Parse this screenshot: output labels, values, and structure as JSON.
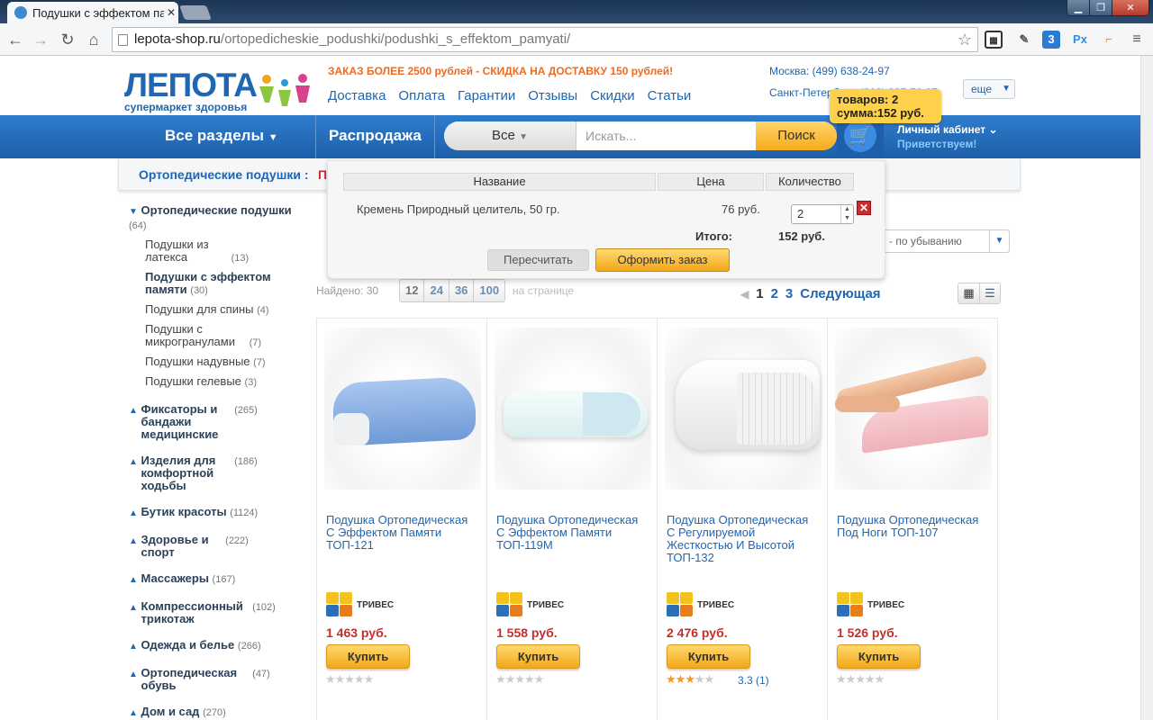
{
  "browser": {
    "tab_title": "Подушки с эффектом па",
    "url_host": "lepota-shop.ru",
    "url_path": "/ortopedicheskie_podushki/podushki_s_effektom_pamyati/"
  },
  "header": {
    "logo_text": "ЛЕПОТА",
    "logo_sub": "супермаркет здоровья",
    "promo": "ЗАКАЗ БОЛЕЕ 2500 рублей - СКИДКА НА ДОСТАВКУ 150 рублей!",
    "nav": [
      "Доставка",
      "Оплата",
      "Гарантии",
      "Отзывы",
      "Скидки",
      "Статьи"
    ],
    "phone_moscow": "Москва: (499) 638-24-97",
    "phone_spb": "Санкт-Петербург: (812) 385-56-97",
    "more_label": "еще"
  },
  "bluebar": {
    "all_sections": "Все разделы",
    "sale": "Распродажа",
    "search_scope": "Все",
    "search_placeholder": "Искать...",
    "search_button": "Поиск",
    "cabinet": "Личный кабинет",
    "greeting": "Приветствуем!"
  },
  "cart_badge": {
    "items": "товаров: 2",
    "sum": "сумма:152 руб."
  },
  "breadcrumb": {
    "parent": "Ортопедические подушки :",
    "current": "П"
  },
  "sidebar": {
    "open_category": {
      "label": "Ортопедические подушки",
      "count": "(64)"
    },
    "subcategories": [
      {
        "label": "Подушки из латекса",
        "count": "(13)"
      },
      {
        "label": "Подушки с эффектом памяти",
        "count": "(30)"
      },
      {
        "label": "Подушки для спины",
        "count": "(4)"
      },
      {
        "label": "Подушки с микрогранулами",
        "count": "(7)"
      },
      {
        "label": "Подушки надувные",
        "count": "(7)"
      },
      {
        "label": "Подушки гелевые",
        "count": "(3)"
      }
    ],
    "categories": [
      {
        "label": "Фиксаторы и бандажи медицинские",
        "count": "(265)"
      },
      {
        "label": "Изделия для комфортной ходьбы",
        "count": "(186)"
      },
      {
        "label": "Бутик красоты",
        "count": "(1124)"
      },
      {
        "label": "Здоровье и спорт",
        "count": "(222)"
      },
      {
        "label": "Массажеры",
        "count": "(167)"
      },
      {
        "label": "Компрессионный трикотаж",
        "count": "(102)"
      },
      {
        "label": "Одежда и белье",
        "count": "(266)"
      },
      {
        "label": "Ортопедическая обувь",
        "count": "(47)"
      },
      {
        "label": "Дом и сад",
        "count": "(270)"
      }
    ]
  },
  "listing": {
    "sort_label": "- по убыванию",
    "found": "Найдено: 30",
    "per_page_options": [
      "12",
      "24",
      "36",
      "100"
    ],
    "per_page_label": "на странице",
    "pages": [
      "1",
      "2",
      "3"
    ],
    "next": "Следующая"
  },
  "products": [
    {
      "title": "Подушка Ортопедическая С Эффектом Памяти ТОП-121",
      "brand": "ТРИВЕС",
      "price": "1 463 руб.",
      "buy": "Купить",
      "stars": 0,
      "rating": ""
    },
    {
      "title": "Подушка Ортопедическая С Эффектом Памяти ТОП-119М",
      "brand": "ТРИВЕС",
      "price": "1 558 руб.",
      "buy": "Купить",
      "stars": 0,
      "rating": ""
    },
    {
      "title": "Подушка Ортопедическая С Регулируемой Жесткостью И Высотой ТОП-132",
      "brand": "ТРИВЕС",
      "price": "2 476 руб.",
      "buy": "Купить",
      "stars": 3.3,
      "rating": "3.3 (1)"
    },
    {
      "title": "Подушка Ортопедическая Под Ноги ТОП-107",
      "brand": "ТРИВЕС",
      "price": "1 526 руб.",
      "buy": "Купить",
      "stars": 0,
      "rating": ""
    }
  ],
  "cart_dropdown": {
    "col_name": "Название",
    "col_price": "Цена",
    "col_qty": "Количество",
    "item_name": "Кремень Природный целитель, 50 гр.",
    "item_price": "76 руб.",
    "item_qty": "2",
    "total_label": "Итого:",
    "total_value": "152 руб.",
    "recalc": "Пересчитать",
    "checkout": "Оформить заказ"
  }
}
